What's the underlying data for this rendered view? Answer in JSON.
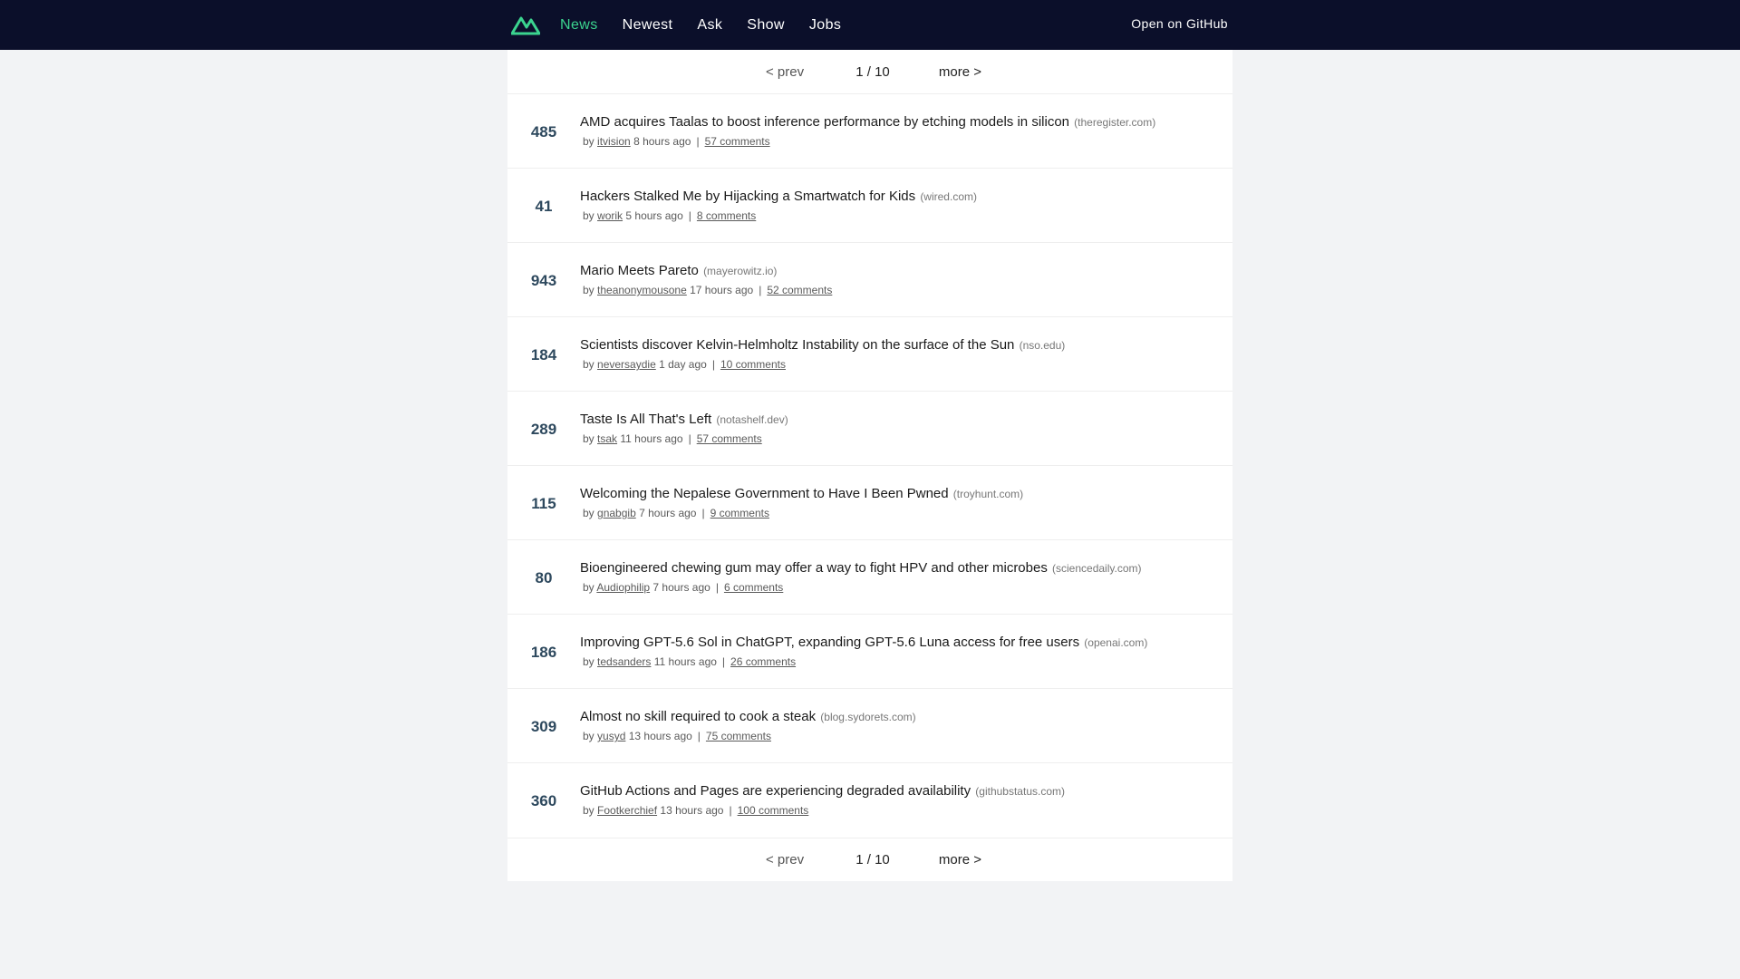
{
  "header": {
    "logo_icon": "vue-hn-logo-icon",
    "nav": [
      {
        "label": "News",
        "active": true
      },
      {
        "label": "Newest",
        "active": false
      },
      {
        "label": "Ask",
        "active": false
      },
      {
        "label": "Show",
        "active": false
      },
      {
        "label": "Jobs",
        "active": false
      }
    ],
    "github": "Open on GitHub"
  },
  "pager": {
    "prev": "< prev",
    "page": "1 / 10",
    "more": "more >"
  },
  "items": [
    {
      "score": "485",
      "title": "AMD acquires Taalas to boost inference performance by etching models in silicon",
      "host": "(theregister.com)",
      "by": "by",
      "user": "itvision",
      "time": "8 hours ago",
      "sep": "|",
      "comments": "57 comments"
    },
    {
      "score": "41",
      "title": "Hackers Stalked Me by Hijacking a Smartwatch for Kids",
      "host": "(wired.com)",
      "by": "by",
      "user": "worik",
      "time": "5 hours ago",
      "sep": "|",
      "comments": "8 comments"
    },
    {
      "score": "943",
      "title": "Mario Meets Pareto",
      "host": "(mayerowitz.io)",
      "by": "by",
      "user": "theanonymousone",
      "time": "17 hours ago",
      "sep": "|",
      "comments": "52 comments"
    },
    {
      "score": "184",
      "title": "Scientists discover Kelvin-Helmholtz Instability on the surface of the Sun",
      "host": "(nso.edu)",
      "by": "by",
      "user": "neversaydie",
      "time": "1 day ago",
      "sep": "|",
      "comments": "10 comments"
    },
    {
      "score": "289",
      "title": "Taste Is All That's Left",
      "host": "(notashelf.dev)",
      "by": "by",
      "user": "tsak",
      "time": "11 hours ago",
      "sep": "|",
      "comments": "57 comments"
    },
    {
      "score": "115",
      "title": "Welcoming the Nepalese Government to Have I Been Pwned",
      "host": "(troyhunt.com)",
      "by": "by",
      "user": "gnabgib",
      "time": "7 hours ago",
      "sep": "|",
      "comments": "9 comments"
    },
    {
      "score": "80",
      "title": "Bioengineered chewing gum may offer a way to fight HPV and other microbes",
      "host": "(sciencedaily.com)",
      "by": "by",
      "user": "Audiophilip",
      "time": "7 hours ago",
      "sep": "|",
      "comments": "6 comments"
    },
    {
      "score": "186",
      "title": "Improving GPT-5.6 Sol in ChatGPT, expanding GPT-5.6 Luna access for free users",
      "host": "(openai.com)",
      "by": "by",
      "user": "tedsanders",
      "time": "11 hours ago",
      "sep": "|",
      "comments": "26 comments"
    },
    {
      "score": "309",
      "title": "Almost no skill required to cook a steak",
      "host": "(blog.sydorets.com)",
      "by": "by",
      "user": "yusyd",
      "time": "13 hours ago",
      "sep": "|",
      "comments": "75 comments"
    },
    {
      "score": "360",
      "title": "GitHub Actions and Pages are experiencing degraded availability",
      "host": "(githubstatus.com)",
      "by": "by",
      "user": "Footkerchief",
      "time": "13 hours ago",
      "sep": "|",
      "comments": "100 comments"
    }
  ],
  "colors": {
    "header_bg": "#0b0f2a",
    "accent": "#3bd48f",
    "score": "#2e495e"
  }
}
